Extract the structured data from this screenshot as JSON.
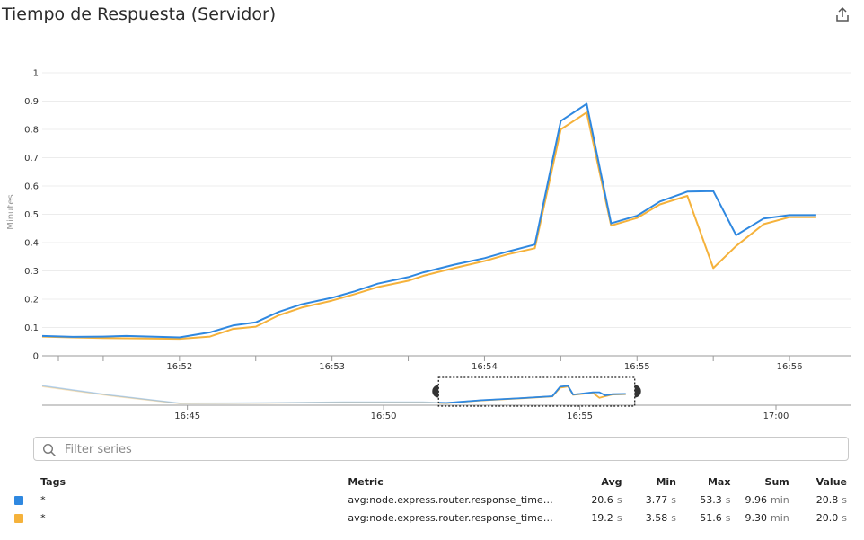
{
  "widget": {
    "title": "Tiempo de Respuesta (Servidor)",
    "share_icon": "share-icon"
  },
  "filter": {
    "placeholder": "Filter series",
    "icon": "search-icon"
  },
  "colors": {
    "series1": "#2f88e0",
    "series2": "#f5b23b",
    "grid": "#ececec",
    "axis": "#999999"
  },
  "legend": {
    "headers": {
      "tags": "Tags",
      "metric": "Metric",
      "avg": "Avg",
      "min": "Min",
      "max": "Max",
      "sum": "Sum",
      "value": "Value"
    },
    "rows": [
      {
        "tag": "*",
        "metric": "avg:node.express.router.response_time.m...",
        "avg": "20.6",
        "avg_unit": "s",
        "min": "3.77",
        "min_unit": "s",
        "max": "53.3",
        "max_unit": "s",
        "sum": "9.96",
        "sum_unit": "min",
        "value": "20.8",
        "value_unit": "s"
      },
      {
        "tag": "*",
        "metric": "avg:node.express.router.response_time.m...",
        "avg": "19.2",
        "avg_unit": "s",
        "min": "3.58",
        "min_unit": "s",
        "max": "51.6",
        "max_unit": "s",
        "sum": "9.30",
        "sum_unit": "min",
        "value": "20.0",
        "value_unit": "s"
      }
    ]
  },
  "chart_data": {
    "type": "line",
    "title": "Tiempo de Respuesta (Servidor)",
    "ylabel": "Minutes",
    "ylim": [
      0,
      1
    ],
    "yticks": [
      "0",
      "0.1",
      "0.2",
      "0.3",
      "0.4",
      "0.5",
      "0.6",
      "0.7",
      "0.8",
      "0.9",
      "1"
    ],
    "xlim": [
      51.1,
      56.4
    ],
    "xticks": [
      {
        "label": "16:52",
        "value": 52
      },
      {
        "label": "16:53",
        "value": 53
      },
      {
        "label": "16:54",
        "value": 54
      },
      {
        "label": "16:55",
        "value": 55
      },
      {
        "label": "16:56",
        "value": 56
      }
    ],
    "grid": true,
    "series": [
      {
        "x": [
          51.1,
          51.3,
          51.5,
          51.65,
          52.0,
          52.2,
          52.35,
          52.5,
          52.65,
          52.8,
          53.0,
          53.15,
          53.3,
          53.5,
          53.6,
          53.8,
          54.0,
          54.15,
          54.33,
          54.5,
          54.67,
          54.83,
          55.0,
          55.15,
          55.33,
          55.5,
          55.65,
          55.83,
          56.0,
          56.17
        ],
        "y": [
          0.07,
          0.067,
          0.068,
          0.07,
          0.065,
          0.083,
          0.107,
          0.118,
          0.155,
          0.182,
          0.205,
          0.228,
          0.255,
          0.278,
          0.295,
          0.322,
          0.345,
          0.368,
          0.393,
          0.83,
          0.89,
          0.468,
          0.495,
          0.545,
          0.58,
          0.582,
          0.426,
          0.485,
          0.497,
          0.497
        ]
      },
      {
        "x": [
          51.1,
          51.3,
          51.5,
          51.65,
          52.0,
          52.2,
          52.35,
          52.5,
          52.65,
          52.8,
          53.0,
          53.15,
          53.3,
          53.5,
          53.6,
          53.8,
          54.0,
          54.15,
          54.33,
          54.5,
          54.67,
          54.83,
          55.0,
          55.15,
          55.33,
          55.5,
          55.65,
          55.83,
          56.0,
          56.17
        ],
        "y": [
          0.068,
          0.065,
          0.063,
          0.062,
          0.06,
          0.068,
          0.095,
          0.103,
          0.143,
          0.17,
          0.195,
          0.218,
          0.243,
          0.265,
          0.283,
          0.31,
          0.335,
          0.358,
          0.38,
          0.8,
          0.86,
          0.46,
          0.487,
          0.535,
          0.565,
          0.31,
          0.388,
          0.465,
          0.49,
          0.49
        ]
      }
    ],
    "overview": {
      "xticks": [
        {
          "label": "16:45",
          "value": 45
        },
        {
          "label": "16:50",
          "value": 50
        },
        {
          "label": "16:55",
          "value": 55
        },
        {
          "label": "17:00",
          "value": 60
        }
      ],
      "xlim": [
        41.3,
        61.9
      ],
      "selection": [
        51.4,
        56.4
      ],
      "series": [
        {
          "x": [
            41.3,
            43.0,
            44.8,
            47.0,
            49.0,
            51.0,
            51.6,
            52.5,
            53.5,
            54.3,
            54.5,
            54.7,
            54.83,
            55.0,
            55.33,
            55.5,
            55.65,
            55.83,
            56.17
          ],
          "y": [
            0.9,
            0.45,
            0.05,
            0.07,
            0.11,
            0.11,
            0.07,
            0.2,
            0.3,
            0.39,
            0.85,
            0.89,
            0.47,
            0.5,
            0.58,
            0.58,
            0.43,
            0.49,
            0.5
          ]
        },
        {
          "x": [
            41.3,
            43.0,
            44.8,
            47.0,
            49.0,
            51.0,
            51.6,
            52.5,
            53.5,
            54.3,
            54.5,
            54.7,
            54.83,
            55.0,
            55.33,
            55.5,
            55.65,
            55.83,
            56.17
          ],
          "y": [
            0.86,
            0.42,
            0.04,
            0.06,
            0.1,
            0.1,
            0.06,
            0.19,
            0.29,
            0.38,
            0.8,
            0.86,
            0.46,
            0.49,
            0.56,
            0.31,
            0.39,
            0.47,
            0.49
          ]
        }
      ]
    }
  }
}
